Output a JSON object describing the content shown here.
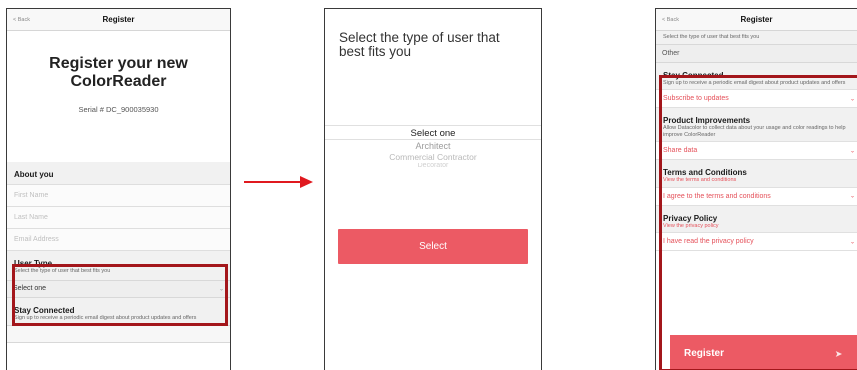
{
  "panel1": {
    "nav": {
      "back": "< Back",
      "title": "Register"
    },
    "hero": "Register your new ColorReader",
    "serial": "Serial # DC_900035930",
    "about": {
      "title": "About you"
    },
    "fields": {
      "first_name": "First Name",
      "last_name": "Last Name",
      "email": "Email Address"
    },
    "user_type": {
      "title": "User Type",
      "desc": "Select the type of user that best fits you",
      "value": "Select one"
    },
    "stay": {
      "title": "Stay Connected",
      "desc": "Sign up to receive a periodic email digest about product updates and offers"
    }
  },
  "panel2": {
    "title": "Select the type of user that best fits you",
    "options": [
      "Select one",
      "Architect",
      "Commercial Contractor",
      "Decorator"
    ],
    "button": "Select"
  },
  "panel3": {
    "nav": {
      "back": "< Back",
      "title": "Register"
    },
    "top": {
      "desc": "Select the type of user that best fits you",
      "value": "Other"
    },
    "stay": {
      "title": "Stay Connected",
      "desc": "Sign up to receive a periodic email digest about product updates and offers",
      "value": "Subscribe to updates"
    },
    "improve": {
      "title": "Product Improvements",
      "desc": "Allow Datacolor to collect data about your usage and color readings to help improve ColorReader",
      "value": "Share data"
    },
    "terms": {
      "title": "Terms and Conditions",
      "link": "View the terms and conditions",
      "value": "I agree to the terms and conditions"
    },
    "privacy": {
      "title": "Privacy Policy",
      "link": "View the privacy policy",
      "value": "I have read the privacy policy"
    },
    "register": "Register"
  },
  "colors": {
    "accent": "#ec5a64",
    "highlight": "#a3161b",
    "arrow": "#e0191f"
  },
  "icons": [
    "chevron-down-icon",
    "send-icon",
    "arrow-right-icon"
  ]
}
